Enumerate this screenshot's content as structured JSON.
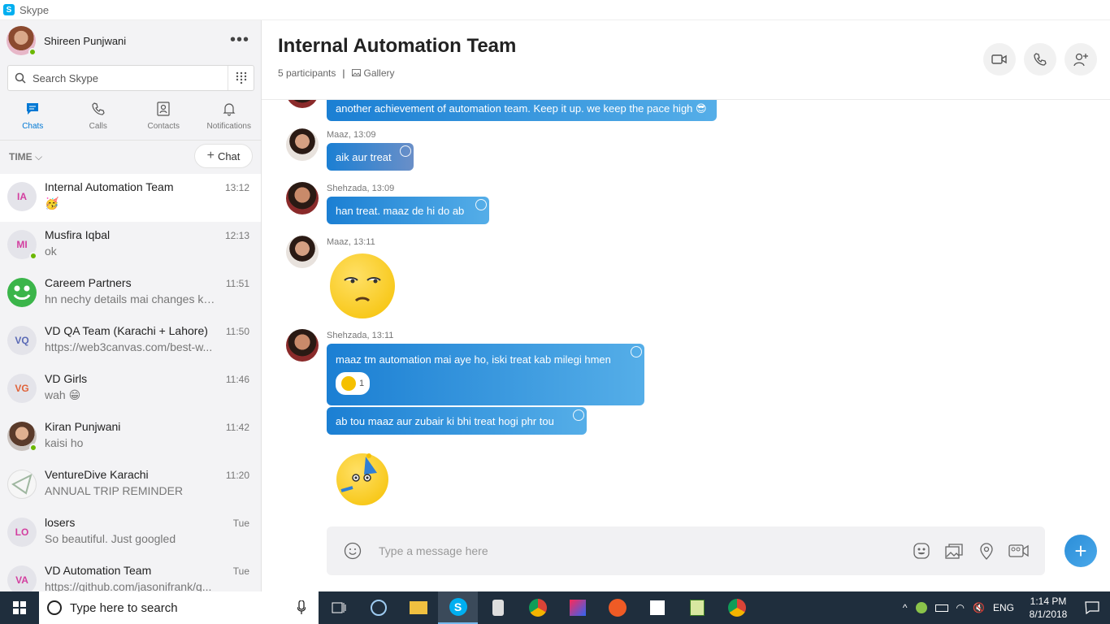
{
  "window": {
    "title": "Skype"
  },
  "profile": {
    "name": "Shireen Punjwani"
  },
  "search": {
    "placeholder": "Search Skype"
  },
  "nav": [
    {
      "label": "Chats"
    },
    {
      "label": "Calls"
    },
    {
      "label": "Contacts"
    },
    {
      "label": "Notifications"
    }
  ],
  "sort": {
    "label": "TIME",
    "new_chat_label": "Chat"
  },
  "chats": [
    {
      "initials": "IA",
      "name": "Internal Automation Team",
      "preview": "🥳",
      "time": "13:12"
    },
    {
      "initials": "MI",
      "name": "Musfira Iqbal",
      "preview": "ok",
      "time": "12:13"
    },
    {
      "initials": "",
      "name": "Careem Partners",
      "preview": "hn nechy details mai changes kr ...",
      "time": "11:51"
    },
    {
      "initials": "VQ",
      "name": "VD QA Team (Karachi + Lahore)",
      "preview": "https://web3canvas.com/best-w...",
      "time": "11:50"
    },
    {
      "initials": "VG",
      "name": "VD Girls",
      "preview": "wah 😁",
      "time": "11:46"
    },
    {
      "initials": "",
      "name": "Kiran Punjwani",
      "preview": "kaisi ho",
      "time": "11:42"
    },
    {
      "initials": "",
      "name": "VentureDive Karachi",
      "preview": "ANNUAL TRIP REMINDER",
      "time": "11:20"
    },
    {
      "initials": "LO",
      "name": "losers",
      "preview": "So beautiful. Just googled",
      "time": "Tue"
    },
    {
      "initials": "VA",
      "name": "VD Automation Team",
      "preview": "https://github.com/jasonifrank/q...",
      "time": "Tue"
    }
  ],
  "conversation": {
    "title": "Internal Automation Team",
    "participants": "5 participants",
    "separator": "|",
    "gallery": "Gallery"
  },
  "messages": {
    "m0": {
      "text": "another achievement of automation team. Keep it up. we keep the pace high 😎"
    },
    "m1": {
      "meta": "Maaz, 13:09",
      "text": "aik aur treat"
    },
    "m2": {
      "meta": "Shehzada, 13:09",
      "text": "han treat. maaz de hi do ab"
    },
    "m3": {
      "meta": "Maaz, 13:11"
    },
    "m4": {
      "meta": "Shehzada, 13:11",
      "text": "maaz tm automation mai aye ho, iski treat kab milegi hmen",
      "reaction_count": "1"
    },
    "m5": {
      "text": "ab tou maaz aur zubair ki bhi treat hogi phr tou"
    }
  },
  "composer": {
    "placeholder": "Type a message here"
  },
  "taskbar": {
    "search_text": "Type here to search",
    "lang": "ENG",
    "time": "1:14 PM",
    "date": "8/1/2018"
  },
  "colors": {
    "accent": "#0078d4",
    "bubble_start": "#1b7fd3",
    "bubble_end": "#55aee8",
    "online": "#6bb700"
  }
}
